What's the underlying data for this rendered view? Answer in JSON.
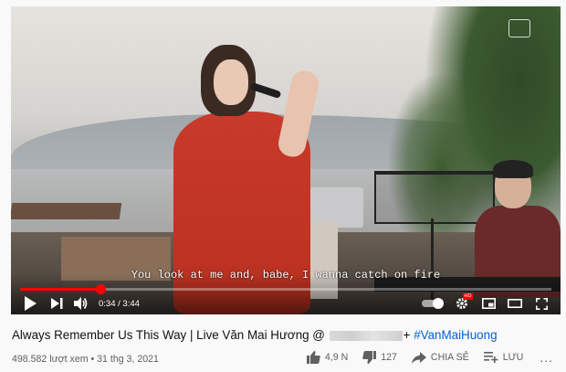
{
  "player": {
    "caption": "You look at me and, babe, I wanna catch on fire",
    "current_time": "0:34",
    "duration": "3:44",
    "time_display": "0:34 / 3:44",
    "progress_fraction": 0.152,
    "progress_color": "#ff0000",
    "settings_badge": "HD"
  },
  "video": {
    "title_prefix": "Always Remember Us This Way | Live Văn Mai Hương @",
    "title_redacted_suffix": "+",
    "hashtag": "#VanMaiHuong",
    "views": "498.582 lượt xem",
    "separator": "•",
    "date": "31 thg 3, 2021"
  },
  "actions": {
    "like_count": "4,9 N",
    "dislike_count": "127",
    "share_label": "CHIA SẺ",
    "save_label": "LƯU",
    "more_label": "..."
  }
}
